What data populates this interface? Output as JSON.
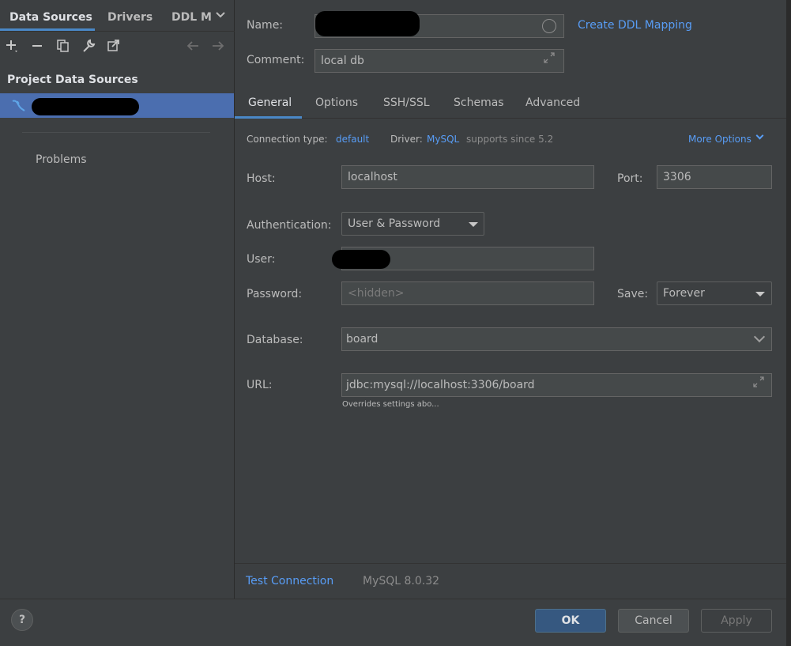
{
  "left_tabs": {
    "data_sources": "Data Sources",
    "drivers": "Drivers",
    "ddl": "DDL M"
  },
  "left": {
    "section_header": "Project Data Sources",
    "problems": "Problems"
  },
  "form": {
    "name_label": "Name:",
    "comment_label": "Comment:",
    "comment_value": "local db",
    "create_ddl_mapping": "Create DDL Mapping",
    "sub_tabs": [
      "General",
      "Options",
      "SSH/SSL",
      "Schemas",
      "Advanced"
    ],
    "connection_type_label": "Connection type:",
    "connection_type_value": "default",
    "driver_label": "Driver:",
    "driver_value": "MySQL",
    "driver_support": "supports since 5.2",
    "more_options": "More Options",
    "host_label": "Host:",
    "host_value": "localhost",
    "port_label": "Port:",
    "port_value": "3306",
    "auth_label": "Authentication:",
    "auth_value": "User & Password",
    "user_label": "User:",
    "password_label": "Password:",
    "password_placeholder": "<hidden>",
    "save_label": "Save:",
    "save_value": "Forever",
    "database_label": "Database:",
    "database_value": "board",
    "url_label": "URL:",
    "url_value": "jdbc:mysql://localhost:3306/board",
    "url_hint": "Overrides settings abo..."
  },
  "bottom": {
    "test_connection": "Test Connection",
    "version": "MySQL 8.0.32"
  },
  "footer": {
    "ok": "OK",
    "cancel": "Cancel",
    "apply": "Apply",
    "help": "?"
  },
  "colors": {
    "accent": "#4a88c7",
    "link": "#589df6",
    "selection": "#4b6eaf",
    "background": "#3c3f41"
  },
  "icons": [
    "add-icon",
    "remove-icon",
    "copy-icon",
    "wrench-icon",
    "jump-icon",
    "back-arrow-icon",
    "forward-arrow-icon",
    "mysql-icon",
    "expand-icon",
    "help-icon"
  ]
}
